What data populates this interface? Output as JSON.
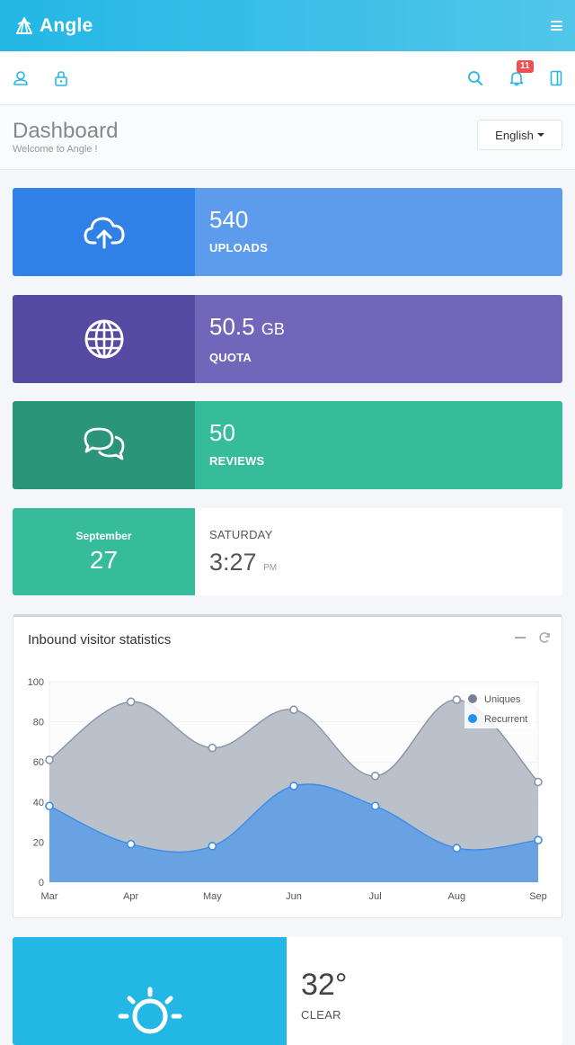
{
  "app": {
    "brand": "Angle"
  },
  "toolbar": {
    "notification_count": "11"
  },
  "heading": {
    "title": "Dashboard",
    "subtitle": "Welcome to Angle !",
    "language": "English"
  },
  "stats": {
    "uploads": {
      "value": "540",
      "label": "UPLOADS",
      "icon": "cloud-upload-icon"
    },
    "quota": {
      "value": "50.5",
      "unit": "GB",
      "label": "QUOTA",
      "icon": "globe-icon"
    },
    "reviews": {
      "value": "50",
      "label": "REVIEWS",
      "icon": "chat-bubbles-icon"
    }
  },
  "date": {
    "month": "September",
    "day": "27",
    "weekday": "SATURDAY",
    "time": "3:27",
    "ampm": "PM"
  },
  "panel": {
    "title": "Inbound visitor statistics"
  },
  "chart_data": {
    "type": "area",
    "categories": [
      "Mar",
      "Apr",
      "May",
      "Jun",
      "Jul",
      "Aug",
      "Sep"
    ],
    "ylim": [
      0,
      100
    ],
    "yticks": [
      0,
      20,
      40,
      60,
      80,
      100
    ],
    "legend_position": "top-right",
    "series": [
      {
        "name": "Uniques",
        "values": [
          61,
          90,
          67,
          86,
          53,
          91,
          50
        ],
        "color": "#768294"
      },
      {
        "name": "Recurrent",
        "values": [
          38,
          19,
          18,
          48,
          38,
          17,
          21
        ],
        "color": "#1f94f4"
      }
    ]
  },
  "weather": {
    "temp": "32°",
    "condition": "CLEAR",
    "icon": "sun-icon"
  },
  "colors": {
    "header": "#23b7e5",
    "uploads_dark": "#2f80e7",
    "uploads": "#5d9cec",
    "quota_dark": "#564aa3",
    "quota": "#7266ba",
    "reviews_dark": "#2b957a",
    "reviews": "#37bc9b"
  }
}
